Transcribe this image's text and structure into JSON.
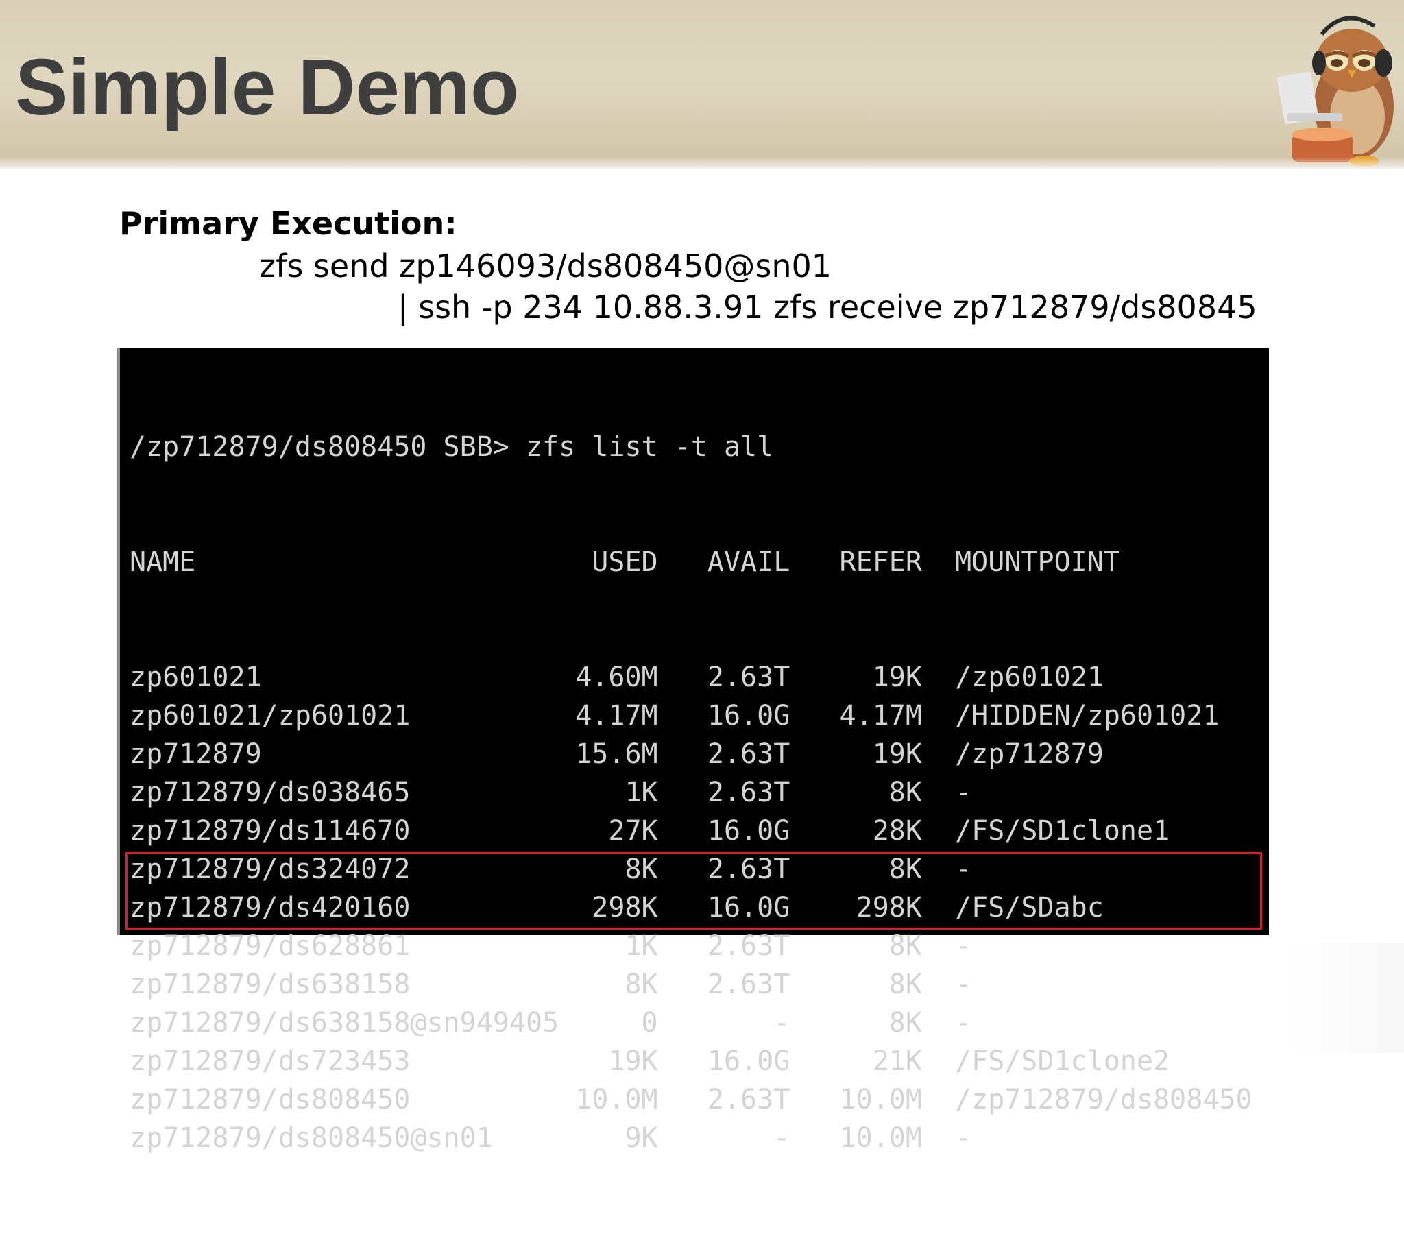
{
  "slide": {
    "title": "Simple Demo"
  },
  "execution": {
    "label": "Primary Execution:",
    "command_line_1": "zfs send zp146093/ds808450@sn01",
    "command_line_2": "| ssh -p 234 10.88.3.91 zfs receive zp712879/ds80845"
  },
  "terminal": {
    "prompt": "/zp712879/ds808450 SBB> zfs list -t all",
    "columns": [
      "NAME",
      "USED",
      "AVAIL",
      "REFER",
      "MOUNTPOINT"
    ],
    "rows": [
      {
        "name": "zp601021",
        "used": "4.60M",
        "avail": "2.63T",
        "refer": "19K",
        "mountpoint": "/zp601021"
      },
      {
        "name": "zp601021/zp601021",
        "used": "4.17M",
        "avail": "16.0G",
        "refer": "4.17M",
        "mountpoint": "/HIDDEN/zp601021"
      },
      {
        "name": "zp712879",
        "used": "15.6M",
        "avail": "2.63T",
        "refer": "19K",
        "mountpoint": "/zp712879"
      },
      {
        "name": "zp712879/ds038465",
        "used": "1K",
        "avail": "2.63T",
        "refer": "8K",
        "mountpoint": "-"
      },
      {
        "name": "zp712879/ds114670",
        "used": "27K",
        "avail": "16.0G",
        "refer": "28K",
        "mountpoint": "/FS/SD1clone1"
      },
      {
        "name": "zp712879/ds324072",
        "used": "8K",
        "avail": "2.63T",
        "refer": "8K",
        "mountpoint": "-"
      },
      {
        "name": "zp712879/ds420160",
        "used": "298K",
        "avail": "16.0G",
        "refer": "298K",
        "mountpoint": "/FS/SDabc"
      },
      {
        "name": "zp712879/ds628861",
        "used": "1K",
        "avail": "2.63T",
        "refer": "8K",
        "mountpoint": "-"
      },
      {
        "name": "zp712879/ds638158",
        "used": "8K",
        "avail": "2.63T",
        "refer": "8K",
        "mountpoint": "-"
      },
      {
        "name": "zp712879/ds638158@sn949405",
        "used": "0",
        "avail": "-",
        "refer": "8K",
        "mountpoint": "-"
      },
      {
        "name": "zp712879/ds723453",
        "used": "19K",
        "avail": "16.0G",
        "refer": "21K",
        "mountpoint": "/FS/SD1clone2"
      },
      {
        "name": "zp712879/ds808450",
        "used": "10.0M",
        "avail": "2.63T",
        "refer": "10.0M",
        "mountpoint": "/zp712879/ds808450"
      },
      {
        "name": "zp712879/ds808450@sn01",
        "used": "9K",
        "avail": "-",
        "refer": "10.0M",
        "mountpoint": "-"
      }
    ],
    "highlighted_rows": [
      11,
      12
    ],
    "highlight_color": "#d2232a",
    "text_color": "#d4d4d4",
    "background_color": "#000000"
  },
  "decoration": {
    "icon": "owl-with-laptop-icon"
  }
}
